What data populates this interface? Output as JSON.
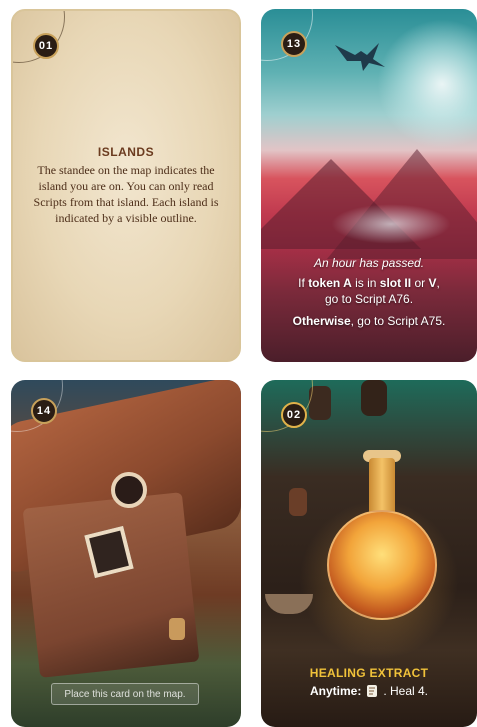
{
  "cards": [
    {
      "number": "01",
      "title": "ISLANDS",
      "body": "The standee on the map indicates the island you are on. You can only read Scripts from that island. Each island is indicated by a visible outline."
    },
    {
      "number": "13",
      "intro": "An hour has passed.",
      "cond_if": "If ",
      "cond_token": "token A",
      "cond_is_in": " is in ",
      "cond_slot": "slot II",
      "cond_or": " or ",
      "cond_v": "V",
      "cond_end": ",",
      "cond_go": "go to Script A76.",
      "otherwise_label": "Otherwise",
      "otherwise_rest": ", go to Script A75."
    },
    {
      "number": "14",
      "placeholder": "Place this card on the map."
    },
    {
      "number": "02",
      "title": "HEALING EXTRACT",
      "timing": "Anytime:",
      "effect": ". Heal 4.",
      "icon": "scroll-icon"
    }
  ],
  "colors": {
    "badge_bg": "#2a1d14",
    "title_brown": "#6b3b1f",
    "title_gold": "#f0c23a"
  }
}
